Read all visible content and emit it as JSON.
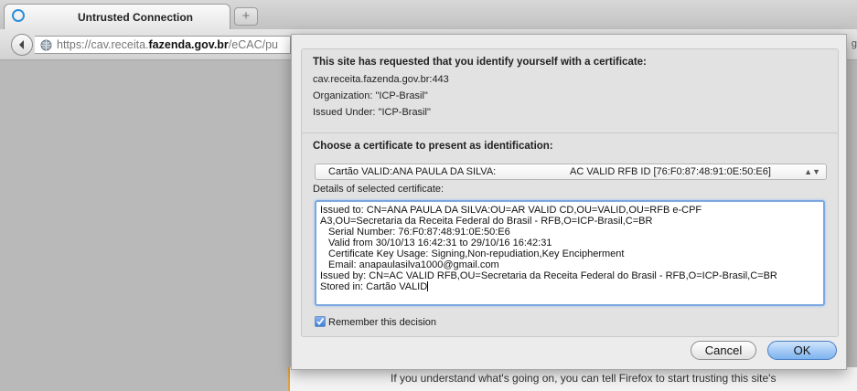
{
  "browser": {
    "tab_title": "Untrusted Connection",
    "new_tab_label": "+",
    "url_prefix": "https://cav.receita.",
    "url_domain": "fazenda.gov.br",
    "url_suffix": "/eCAC/pu",
    "right_edge_fragment": "g"
  },
  "page": {
    "bottom_text": "If you understand what's going on, you can tell Firefox to start trusting this site's"
  },
  "dialog": {
    "request": {
      "heading": "This site has requested that you identify yourself with a certificate:",
      "host": "cav.receita.fazenda.gov.br:443",
      "organization": "Organization: \"ICP-Brasil\"",
      "issued_under": "Issued Under: \"ICP-Brasil\""
    },
    "choose": {
      "heading": "Choose a certificate to present as identification:",
      "selected_left": "Cartão VALID:ANA PAULA DA SILVA:",
      "selected_right": "AC VALID RFB ID [76:F0:87:48:91:0E:50:E6]",
      "details_label": "Details of selected certificate:",
      "details_lines": [
        "Issued to: CN=ANA PAULA DA SILVA:OU=AR VALID CD,OU=VALID,OU=RFB e-CPF",
        "A3,OU=Secretaria da Receita Federal do Brasil - RFB,O=ICP-Brasil,C=BR",
        "Serial Number: 76:F0:87:48:91:0E:50:E6",
        "Valid from 30/10/13 16:42:31 to 29/10/16 16:42:31",
        "Certificate Key Usage: Signing,Non-repudiation,Key Encipherment",
        "Email: anapaulasilva1000@gmail.com",
        "Issued by: CN=AC VALID RFB,OU=Secretaria da Receita Federal do Brasil - RFB,O=ICP-Brasil,C=BR",
        "Stored in: Cartão VALID"
      ],
      "remember_label": "Remember this decision",
      "remember_checked": true
    },
    "buttons": {
      "cancel": "Cancel",
      "ok": "OK"
    }
  }
}
